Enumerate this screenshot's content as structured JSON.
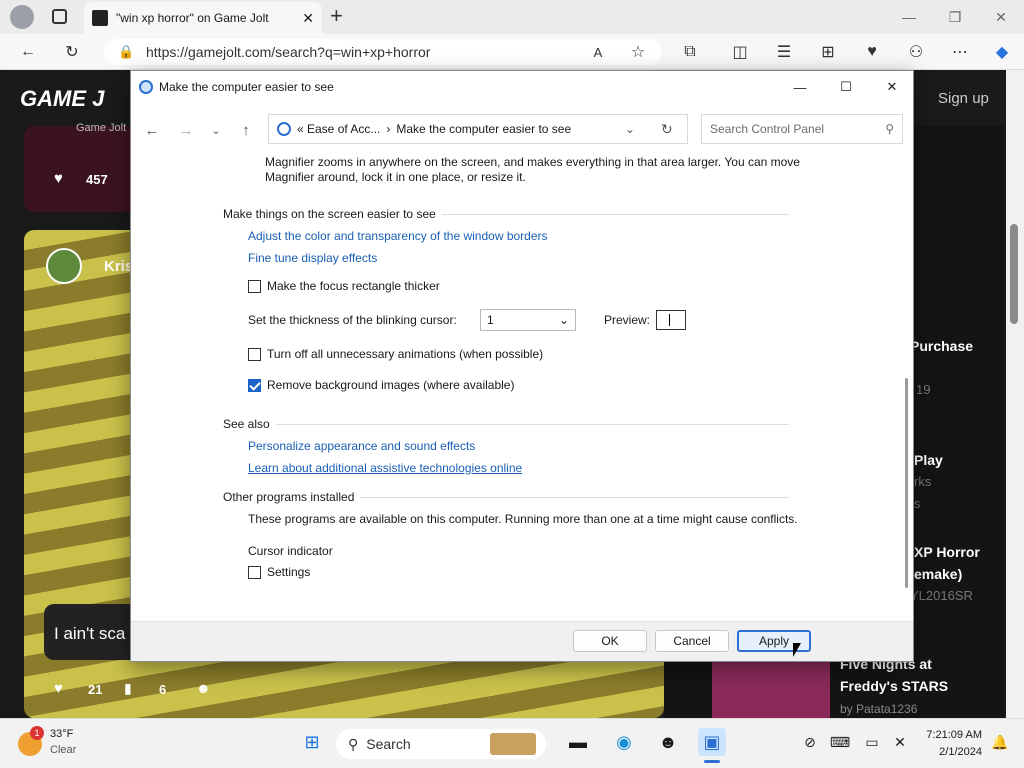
{
  "browser": {
    "tab_title": "\"win xp horror\" on Game Jolt",
    "url": "https://gamejolt.com/search?q=win+xp+horror",
    "new_tab": "+"
  },
  "page": {
    "logo": "GAME J",
    "sign_up": "Sign up",
    "game_jolt_chip": "Game Jolt",
    "likes_1": "457",
    "user": "Kris",
    "comment_text": "I ain't sca",
    "likes_2": "21",
    "comments_2": "6",
    "right_items": [
      "Purchase",
      "19",
      "Play",
      "rks",
      "s",
      "XP Horror",
      "emake)",
      "YL2016SR",
      "Five Nights at",
      "Freddy's STARS",
      "by Patata1236"
    ]
  },
  "dialog": {
    "title": "Make the computer easier to see",
    "breadcrumb_root": "«  Ease of Acc...",
    "breadcrumb_sep": "›",
    "breadcrumb_current": "Make the computer easier to see",
    "search_placeholder": "Search Control Panel",
    "magnifier_text": "Magnifier zooms in anywhere on the screen, and makes everything in that area larger. You can move Magnifier around, lock it in one place, or resize it.",
    "section_easier": "Make things on the screen easier to see",
    "link_color": "Adjust the color and transparency of the window borders",
    "link_display": "Fine tune display effects",
    "cb_focus": "Make the focus rectangle thicker",
    "cursor_label": "Set the thickness of the blinking cursor:",
    "cursor_value": "1",
    "preview_label": "Preview:",
    "cb_animations": "Turn off all unnecessary animations (when possible)",
    "cb_background": "Remove background images (where available)",
    "section_see_also": "See also",
    "link_personalize": "Personalize appearance and sound effects",
    "link_assistive": "Learn about additional assistive technologies online",
    "section_other": "Other programs installed",
    "other_text": "These programs are available on this computer. Running more than one at a time might cause conflicts.",
    "cursor_indicator": "Cursor indicator",
    "cb_settings": "Settings",
    "btn_ok": "OK",
    "btn_cancel": "Cancel",
    "btn_apply": "Apply",
    "checkbox_focus": false,
    "checkbox_animations": false,
    "checkbox_background": true,
    "checkbox_settings": false
  },
  "taskbar": {
    "weather_temp": "33°F",
    "weather_desc": "Clear",
    "weather_badge": "1",
    "search_label": "Search",
    "time": "7:21:09 AM",
    "date": "2/1/2024"
  }
}
